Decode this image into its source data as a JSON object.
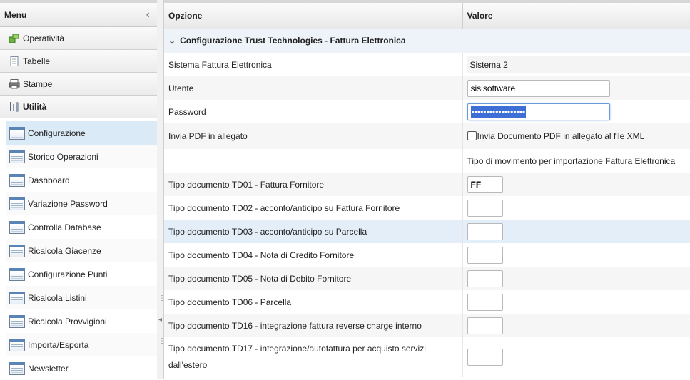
{
  "sidebar": {
    "title": "Menu",
    "collapse_icon": "chevron-left-icon",
    "sections": [
      {
        "label": "Operatività",
        "icon": "operativita-icon"
      },
      {
        "label": "Tabelle",
        "icon": "document-icon"
      },
      {
        "label": "Stampe",
        "icon": "printer-icon"
      },
      {
        "label": "Utilità",
        "icon": "tools-icon"
      }
    ],
    "utility_items": [
      "Configurazione",
      "Storico Operazioni",
      "Dashboard",
      "Variazione Password",
      "Controlla Database",
      "Ricalcola Giacenze",
      "Configurazione Punti",
      "Ricalcola Listini",
      "Ricalcola Provvigioni",
      "Importa/Esporta",
      "Newsletter"
    ],
    "active_item": "Configurazione"
  },
  "grid": {
    "col_option": "Opzione",
    "col_value": "Valore",
    "group_title": "Configurazione Trust Technologies - Fattura Elettronica",
    "rows": {
      "sistema": {
        "label": "Sistema Fattura Elettronica",
        "value": "Sistema 2"
      },
      "utente": {
        "label": "Utente",
        "value": "sisisoftware"
      },
      "password": {
        "label": "Password",
        "value": "••••••••••••••••••"
      },
      "pdf": {
        "label": "Invia PDF in allegato",
        "checkbox_label": "Invia Documento PDF in allegato al file XML",
        "checked": false
      },
      "note": {
        "label": "",
        "value": "Tipo di movimento per importazione Fattura Elettronica"
      },
      "td01": {
        "label": "Tipo documento TD01 - Fattura Fornitore",
        "value": "FF"
      },
      "td02": {
        "label": "Tipo documento TD02 - acconto/anticipo su Fattura Fornitore",
        "value": ""
      },
      "td03": {
        "label": "Tipo documento TD03 - acconto/anticipo su Parcella",
        "value": ""
      },
      "td04": {
        "label": "Tipo documento TD04 - Nota di Credito Fornitore",
        "value": ""
      },
      "td05": {
        "label": "Tipo documento TD05 - Nota di Debito Fornitore",
        "value": ""
      },
      "td06": {
        "label": "Tipo documento TD06 - Parcella",
        "value": ""
      },
      "td16": {
        "label": "Tipo documento TD16 - integrazione fattura reverse charge interno",
        "value": ""
      },
      "td17": {
        "label": "Tipo documento TD17 - integrazione/autofattura per acquisto servizi dall'estero",
        "value": ""
      }
    }
  }
}
